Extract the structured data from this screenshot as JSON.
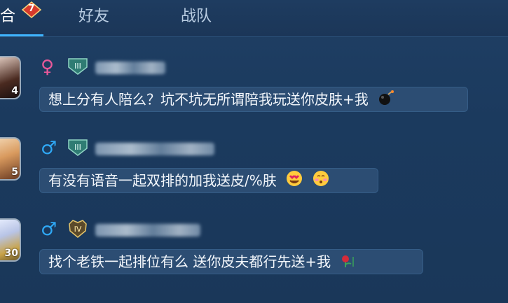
{
  "tabs": [
    {
      "label": "合",
      "active": true,
      "badge": "7"
    },
    {
      "label": "好友",
      "active": false
    },
    {
      "label": "战队",
      "active": false
    }
  ],
  "messages": [
    {
      "gender": "♀",
      "gender_color": "#e9599a",
      "rank": "III",
      "avatar_level": "4",
      "text": "想上分有人陪么？坑不坑无所谓陪我玩送你皮肤+我",
      "emojis": [
        "bomb-icon"
      ]
    },
    {
      "gender": "♂",
      "gender_color": "#2fa8f5",
      "rank": "III",
      "avatar_level": "5",
      "text": "有没有语音一起双排的加我送皮/%肤",
      "emojis": [
        "heart-eyes-emoji-icon",
        "blush-emoji-icon"
      ]
    },
    {
      "gender": "♂",
      "gender_color": "#2fa8f5",
      "rank": "IV",
      "avatar_level": "30",
      "text": "找个老铁一起排位有么 送你皮夫都行先送+我",
      "emojis": [
        "rose-icon"
      ]
    }
  ]
}
